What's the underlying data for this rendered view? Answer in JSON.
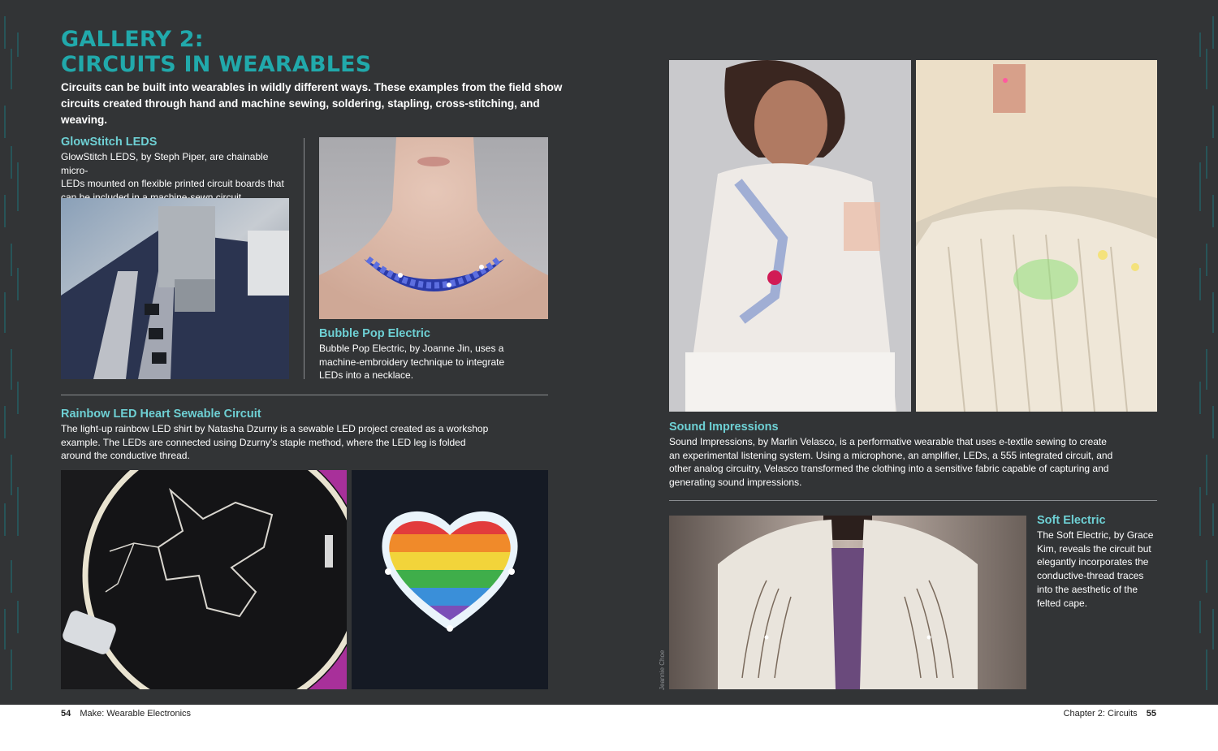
{
  "gallery": {
    "title_line1": "GALLERY 2:",
    "title_line2": "CIRCUITS IN WEARABLES",
    "intro_line1": "Circuits can be built into wearables in wildly different ways. These examples from the field show",
    "intro_line2": "circuits created through hand and machine sewing, soldering, stapling, cross-stitching, and weaving."
  },
  "glowstitch": {
    "heading": "GlowStitch LEDS",
    "lines": [
      "GlowStitch LEDS, by Steph Piper, are chainable micro-",
      "LEDs mounted on flexible printed circuit boards that",
      "can be included in a machine-sewn circuit."
    ]
  },
  "bubble_pop": {
    "heading": "Bubble Pop Electric",
    "lines": [
      "Bubble Pop Electric, by Joanne Jin, uses a",
      "machine-embroidery technique to integrate",
      "LEDs into a necklace."
    ]
  },
  "rainbow": {
    "heading": "Rainbow LED Heart Sewable Circuit",
    "lines": [
      "The light-up rainbow LED shirt by Natasha Dzurny is a sewable LED project created as a workshop",
      "example. The LEDs are connected using Dzurny’s staple method, where the LED leg is folded",
      "around the conductive thread."
    ]
  },
  "sound": {
    "heading": "Sound Impressions",
    "lines": [
      "Sound Impressions, by Marlin Velasco, is a performative wearable that uses e-textile sewing to create",
      "an experimental listening system. Using a microphone, an amplifier, LEDs, a 555 integrated circuit, and",
      "other analog circuitry, Velasco transformed the clothing into a sensitive fabric capable of capturing and",
      "generating sound impressions."
    ]
  },
  "soft_electric": {
    "heading": "Soft Electric",
    "lines": [
      "The Soft Electric, by Grace",
      "Kim, reveals the circuit but",
      "elegantly incorporates the",
      "conductive-thread traces",
      "into the aesthetic of the",
      "felted cape."
    ]
  },
  "photo_credit": "Jeannie Choe",
  "footer": {
    "left_page": "54",
    "left_title": "Make: Wearable Electronics",
    "right_chapter": "Chapter 2:",
    "right_title": "Circuits",
    "right_page": "55"
  },
  "colors": {
    "background": "#323436",
    "title": "#21a9ab",
    "heading": "#6ed0d4"
  }
}
